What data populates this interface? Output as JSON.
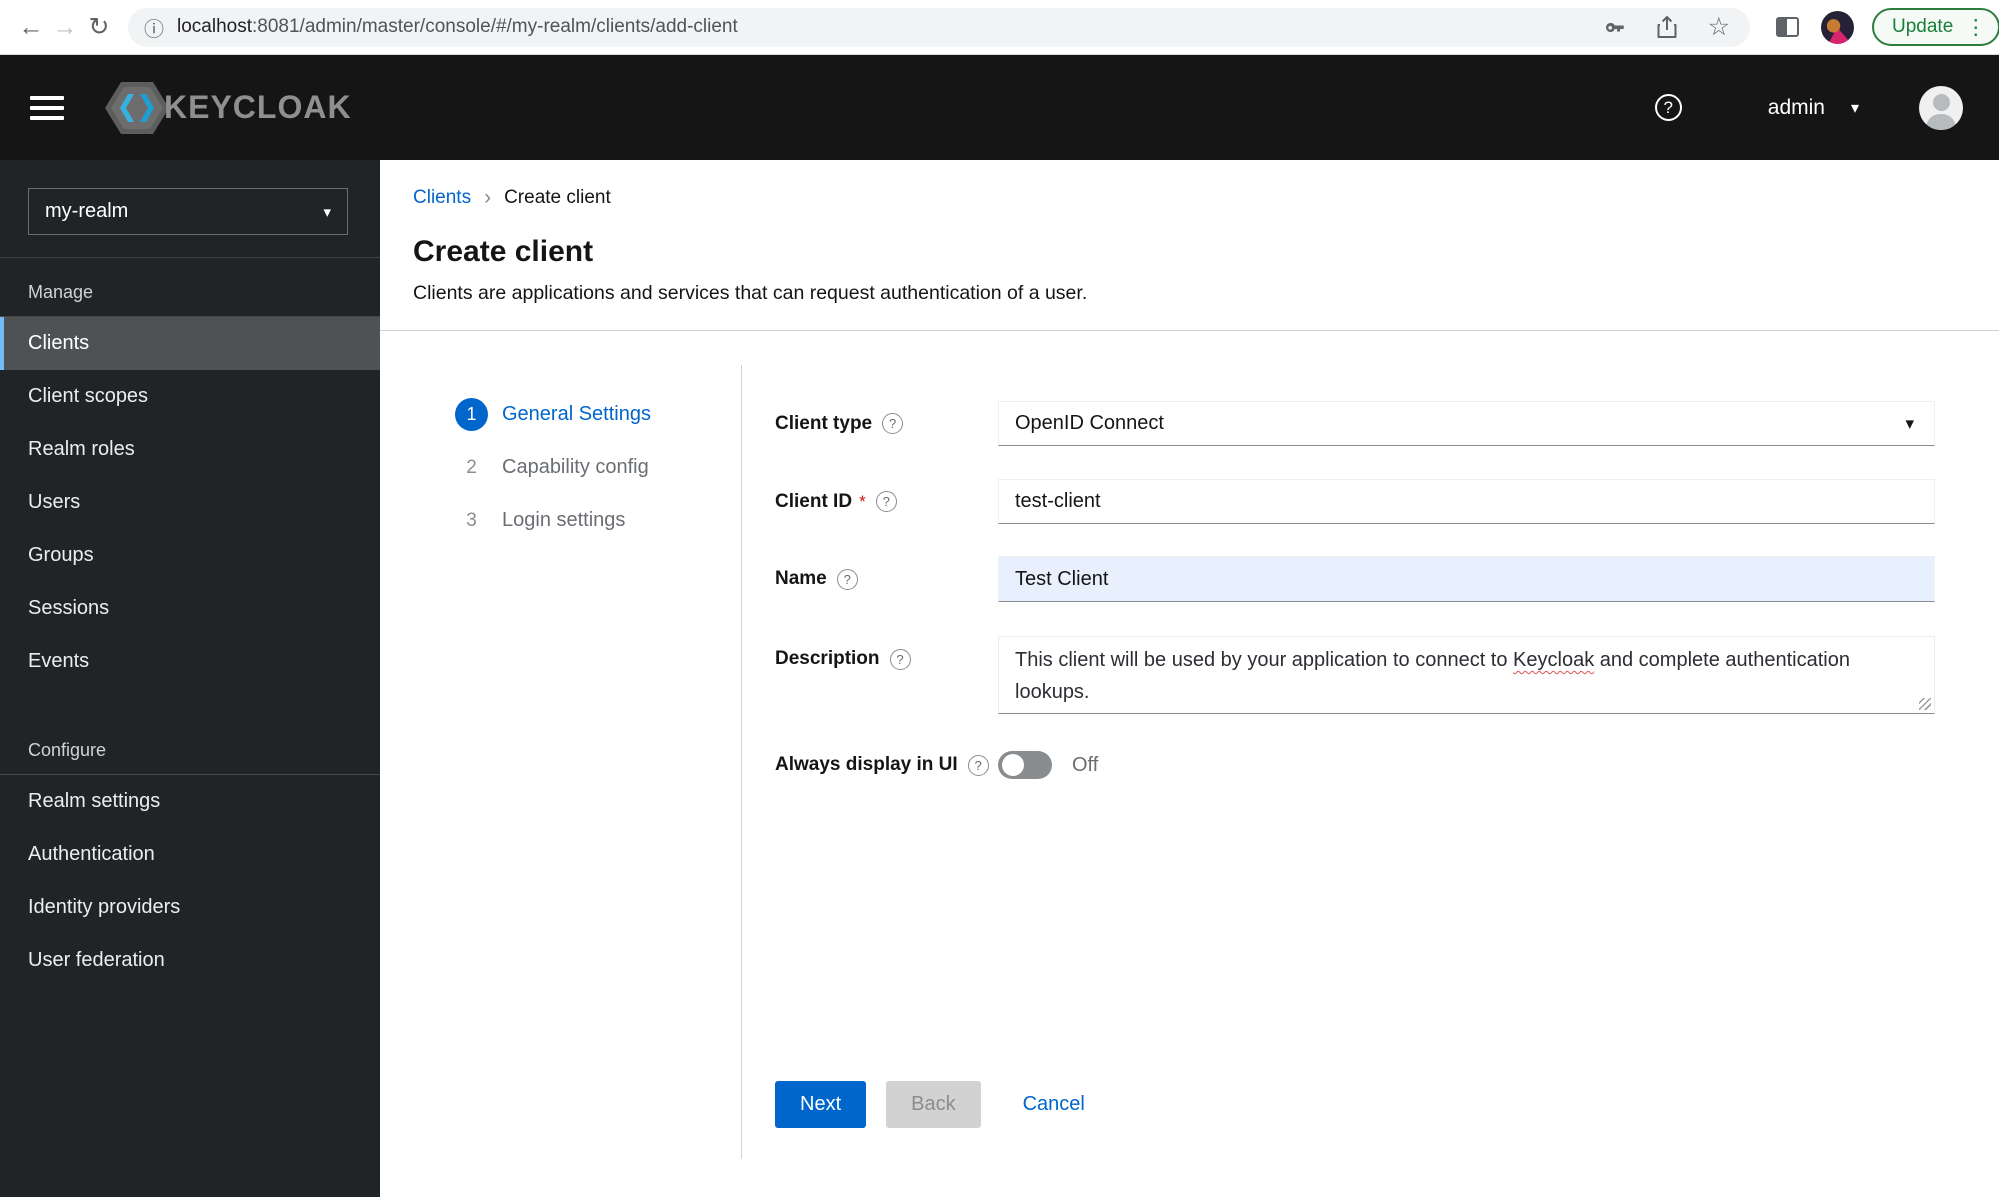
{
  "browser": {
    "url_host": "localhost",
    "url_rest": ":8081/admin/master/console/#/my-realm/clients/add-client",
    "update_label": "Update"
  },
  "header": {
    "brand": "KEYCLOAK",
    "username": "admin"
  },
  "sidebar": {
    "realm": "my-realm",
    "groups": [
      {
        "title": "Manage",
        "items": [
          {
            "label": "Clients"
          },
          {
            "label": "Client scopes"
          },
          {
            "label": "Realm roles"
          },
          {
            "label": "Users"
          },
          {
            "label": "Groups"
          },
          {
            "label": "Sessions"
          },
          {
            "label": "Events"
          }
        ]
      },
      {
        "title": "Configure",
        "items": [
          {
            "label": "Realm settings"
          },
          {
            "label": "Authentication"
          },
          {
            "label": "Identity providers"
          },
          {
            "label": "User federation"
          }
        ]
      }
    ]
  },
  "breadcrumb": {
    "parent": "Clients",
    "current": "Create client"
  },
  "page": {
    "title": "Create client",
    "subtitle": "Clients are applications and services that can request authentication of a user."
  },
  "wizard": {
    "steps": [
      {
        "number": "1",
        "label": "General Settings"
      },
      {
        "number": "2",
        "label": "Capability config"
      },
      {
        "number": "3",
        "label": "Login settings"
      }
    ]
  },
  "form": {
    "client_type": {
      "label": "Client type",
      "value": "OpenID Connect"
    },
    "client_id": {
      "label": "Client ID",
      "required_mark": "*",
      "value": "test-client"
    },
    "name": {
      "label": "Name",
      "value": "Test Client"
    },
    "description": {
      "label": "Description",
      "value_pre": "This client will be used by your application to connect to ",
      "value_flagged": "Keycloak",
      "value_post": " and complete authentication lookups."
    },
    "always_display": {
      "label": "Always display in UI",
      "state": "Off"
    }
  },
  "actions": {
    "next": "Next",
    "back": "Back",
    "cancel": "Cancel"
  },
  "icons": {
    "back_arrow": "←",
    "forward_arrow": "→",
    "reload": "↻",
    "info": "ⓘ",
    "star": "☆",
    "dots": "⋮",
    "question": "?",
    "caret_down": "▾",
    "breadcrumb_separator": "›"
  },
  "colors": {
    "accent": "#0066cc",
    "masthead": "#151515",
    "sidebar": "#212427",
    "nav_active_accent": "#73bcf7",
    "autofill_blue": "#e8f0fe",
    "update_green": "#188038",
    "danger": "#c9190b"
  }
}
